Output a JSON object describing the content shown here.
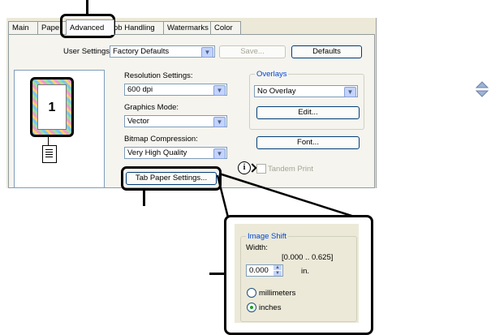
{
  "tabs": [
    {
      "label": "Main",
      "active": false
    },
    {
      "label": "Pape",
      "active": false
    },
    {
      "label": "Advanced",
      "active": true
    },
    {
      "label": "ob Handling",
      "active": false
    },
    {
      "label": "Watermarks",
      "active": false
    },
    {
      "label": "Color",
      "active": false
    }
  ],
  "user_settings": {
    "label": "User Settings",
    "value": "Factory Defaults",
    "save_label": "Save...",
    "defaults_label": "Defaults"
  },
  "preview": {
    "page_number": "1"
  },
  "resolution": {
    "label": "Resolution Settings:",
    "value": "600 dpi"
  },
  "graphics": {
    "label": "Graphics Mode:",
    "value": "Vector"
  },
  "bitmap": {
    "label": "Bitmap Compression:",
    "value": "Very High Quality"
  },
  "overlays": {
    "title": "Overlays",
    "value": "No Overlay",
    "edit_label": "Edit..."
  },
  "font_label": "Font...",
  "tandem_label": "Tandem Print",
  "info_icon_glyph": "i",
  "tab_paper_label": "Tab Paper Settings...",
  "image_shift": {
    "title": "Image Shift",
    "width_label": "Width:",
    "range": "[0.000 .. 0.625]",
    "value": "0.000",
    "unit": "in.",
    "millimeters_label": "millimeters",
    "inches_label": "inches",
    "selected_unit": "inches"
  },
  "icons": {
    "combo_arrow": "▼",
    "spin_up": "▲",
    "spin_down": "▼"
  },
  "colors": {
    "callout": "#000000",
    "dialog_bg": "#ece9d8",
    "accent_blue": "#7f9db9"
  }
}
